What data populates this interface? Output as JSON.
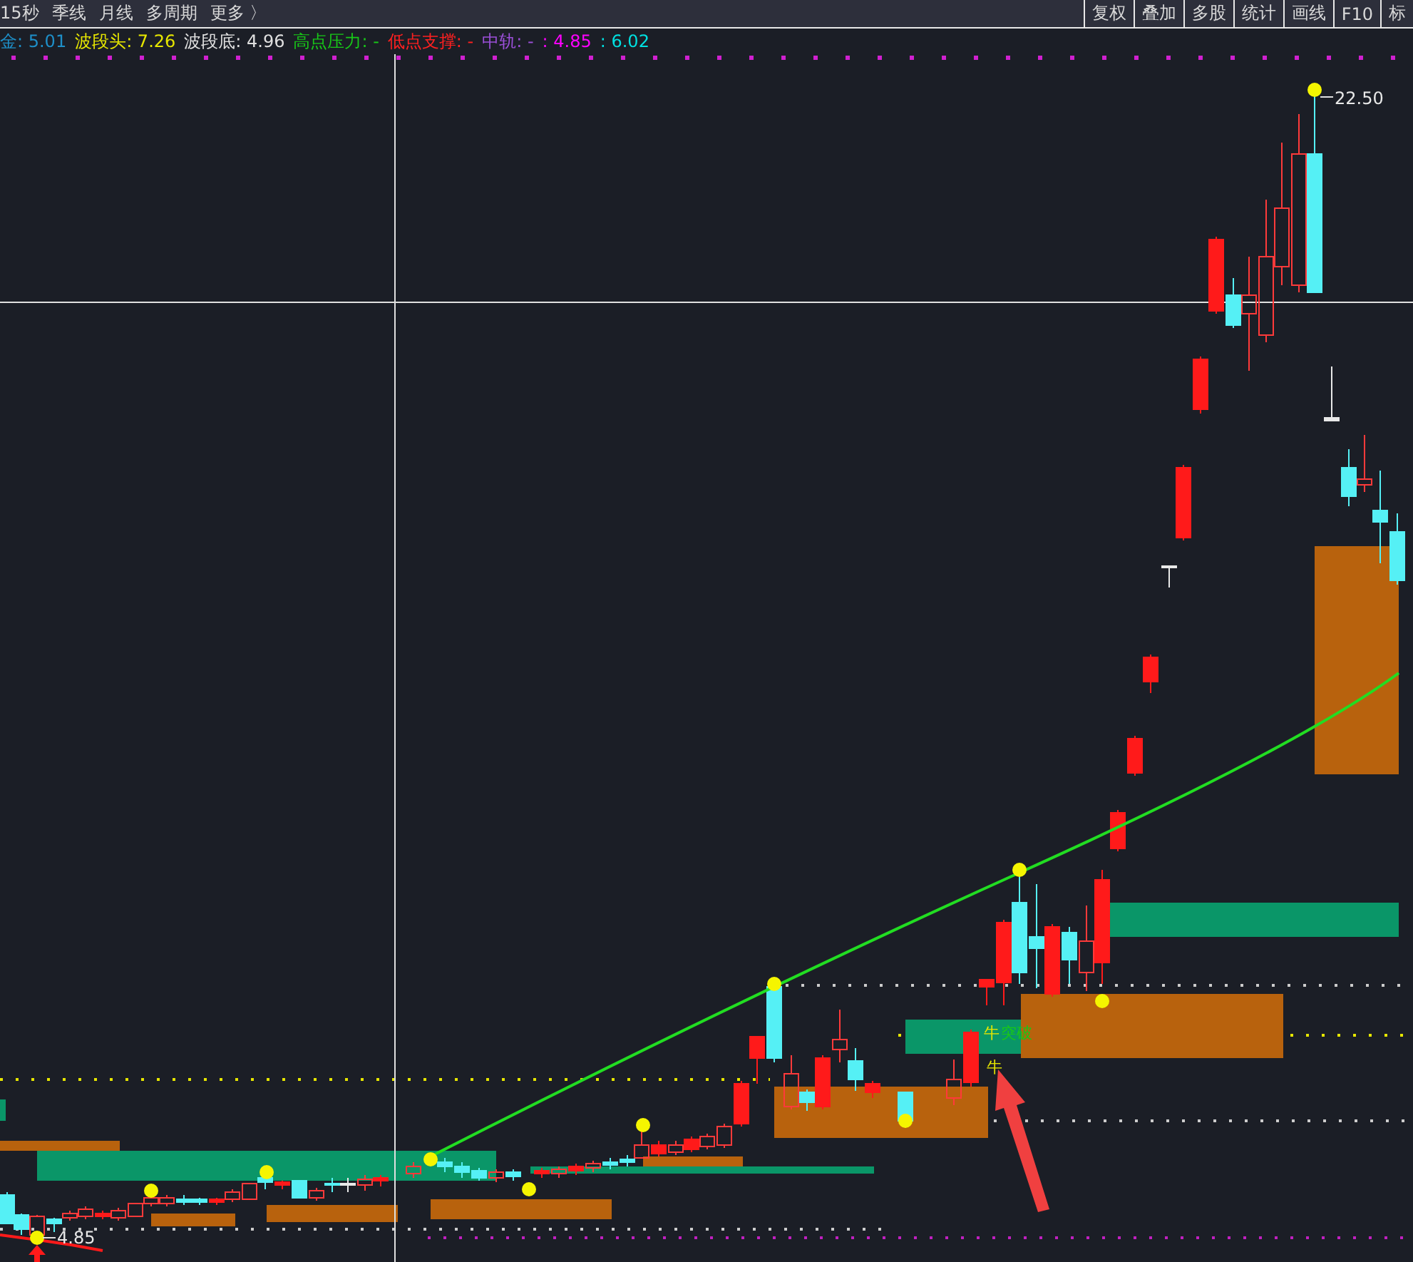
{
  "toolbar": {
    "left_items": [
      "15秒",
      "季线",
      "月线",
      "多周期",
      "更多 〉"
    ],
    "right_buttons": [
      "复权",
      "叠加",
      "多股",
      "统计",
      "画线",
      "F10",
      "标"
    ]
  },
  "legend": [
    {
      "text": "金: 5.01",
      "color": "#1e8fc8"
    },
    {
      "text": "波段头: 7.26",
      "color": "#e6e600"
    },
    {
      "text": "波段底: 4.96",
      "color": "#e0e0e0"
    },
    {
      "text": "高点压力: -",
      "color": "#18c818"
    },
    {
      "text": "低点支撑: -",
      "color": "#ff2020"
    },
    {
      "text": "中轨: -",
      "color": "#9b4fd8"
    },
    {
      "text": ": 4.85",
      "color": "#ff00ff"
    },
    {
      "text": ": 6.02",
      "color": "#00e0e0"
    }
  ],
  "chart": {
    "high_label": "22.50",
    "low_label": "4.85",
    "signals": [
      {
        "text": "牛",
        "color": "#e6e600"
      },
      {
        "text": "突破",
        "color": "#18c818"
      },
      {
        "text": "牛",
        "color": "#e6e600"
      }
    ]
  }
}
